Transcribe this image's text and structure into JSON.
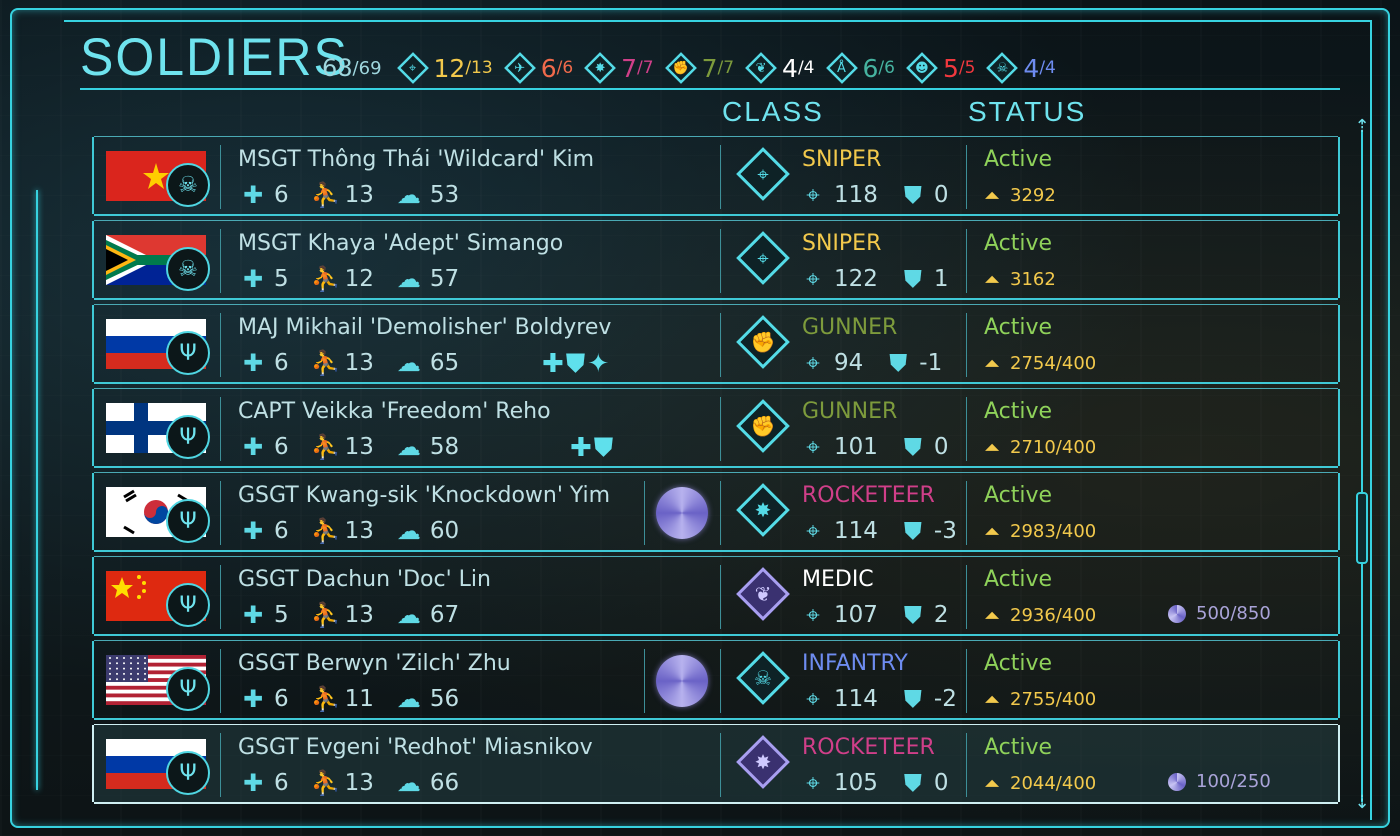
{
  "screen": {
    "title": "SOLDIERS",
    "total": {
      "count": "68",
      "max": "/69"
    },
    "class_counts": [
      {
        "icon": "sniper-class-icon",
        "count": "12",
        "max": "/13",
        "color": "#f2c94c"
      },
      {
        "icon": "scout-class-icon",
        "count": "6",
        "max": "/6",
        "color": "#f06a4b"
      },
      {
        "icon": "rocketeer-class-icon",
        "count": "7",
        "max": "/7",
        "color": "#d03f89"
      },
      {
        "icon": "gunner-class-icon",
        "count": "7",
        "max": "/7",
        "color": "#7d9b3c"
      },
      {
        "icon": "medic-class-icon",
        "count": "4",
        "max": "/4",
        "color": "#ffffff"
      },
      {
        "icon": "engineer-class-icon",
        "count": "6",
        "max": "/6",
        "color": "#46b3a0"
      },
      {
        "icon": "alien-class-icon",
        "count": "5",
        "max": "/5",
        "color": "#f0383e"
      },
      {
        "icon": "infantry-class-icon",
        "count": "4",
        "max": "/4",
        "color": "#6e8cf0"
      }
    ],
    "col_class": "CLASS",
    "col_status": "STATUS"
  },
  "soldiers": [
    {
      "name": "MSGT Thông Thái 'Wildcard' Kim",
      "flag": "vietnam",
      "rank_icon": "laurel-skull-icon",
      "hp": "6",
      "mobility": "13",
      "will": "53",
      "perks": [],
      "psi_gift": false,
      "class": "SNIPER",
      "class_color": "#f2c94c",
      "class_icon": "sniper-class-icon",
      "aim": "118",
      "defense": "0",
      "status": "Active",
      "xp": "3292",
      "psi_xp": ""
    },
    {
      "name": "MSGT Khaya 'Adept' Simango",
      "flag": "south-africa",
      "rank_icon": "laurel-skull-icon",
      "hp": "5",
      "mobility": "12",
      "will": "57",
      "perks": [],
      "psi_gift": false,
      "class": "SNIPER",
      "class_color": "#f2c94c",
      "class_icon": "sniper-class-icon",
      "aim": "122",
      "defense": "1",
      "status": "Active",
      "xp": "3162",
      "psi_xp": ""
    },
    {
      "name": "MAJ Mikhail 'Demolisher' Boldyrev",
      "flag": "russia",
      "rank_icon": "trident-rank-icon",
      "hp": "6",
      "mobility": "13",
      "will": "65",
      "perks": [
        "health-perk-icon",
        "shield-perk-icon",
        "mobility-perk-icon"
      ],
      "psi_gift": false,
      "class": "GUNNER",
      "class_color": "#7d9b3c",
      "class_icon": "gunner-class-icon",
      "aim": "94",
      "defense": "-1",
      "status": "Active",
      "xp": "2754/400",
      "psi_xp": ""
    },
    {
      "name": "CAPT Veikka 'Freedom' Reho",
      "flag": "finland",
      "rank_icon": "trident-rank-icon",
      "hp": "6",
      "mobility": "13",
      "will": "58",
      "perks": [
        "health-perk-icon",
        "shield-perk-icon"
      ],
      "psi_gift": false,
      "class": "GUNNER",
      "class_color": "#7d9b3c",
      "class_icon": "gunner-class-icon",
      "aim": "101",
      "defense": "0",
      "status": "Active",
      "xp": "2710/400",
      "psi_xp": ""
    },
    {
      "name": "GSGT Kwang-sik 'Knockdown' Yim",
      "flag": "south-korea",
      "rank_icon": "trident-rank-icon",
      "hp": "6",
      "mobility": "13",
      "will": "60",
      "perks": [],
      "psi_gift": true,
      "class": "ROCKETEER",
      "class_color": "#d03f89",
      "class_icon": "rocketeer-class-icon",
      "aim": "114",
      "defense": "-3",
      "status": "Active",
      "xp": "2983/400",
      "psi_xp": ""
    },
    {
      "name": "GSGT Dachun 'Doc' Lin",
      "flag": "china",
      "rank_icon": "trident-rank-icon",
      "hp": "5",
      "mobility": "13",
      "will": "67",
      "perks": [],
      "psi_gift": false,
      "class": "MEDIC",
      "class_color": "#ffffff",
      "class_icon": "medic-class-icon",
      "aim": "107",
      "defense": "2",
      "status": "Active",
      "xp": "2936/400",
      "psi_xp": "500/850"
    },
    {
      "name": "GSGT Berwyn 'Zilch' Zhu",
      "flag": "usa",
      "rank_icon": "trident-rank-icon",
      "hp": "6",
      "mobility": "11",
      "will": "56",
      "perks": [],
      "psi_gift": true,
      "class": "INFANTRY",
      "class_color": "#6e8cf0",
      "class_icon": "infantry-class-icon",
      "aim": "114",
      "defense": "-2",
      "status": "Active",
      "xp": "2755/400",
      "psi_xp": ""
    },
    {
      "name": "GSGT Evgeni 'Redhot' Miasnikov",
      "flag": "russia",
      "rank_icon": "trident-rank-icon",
      "hp": "6",
      "mobility": "13",
      "will": "66",
      "perks": [],
      "psi_gift": false,
      "class": "ROCKETEER",
      "class_color": "#d03f89",
      "class_icon": "rocketeer-psi-class-icon",
      "aim": "105",
      "defense": "0",
      "status": "Active",
      "xp": "2044/400",
      "psi_xp": "100/250"
    }
  ],
  "selected_index": 7,
  "colors": {
    "accent": "#37d2e0",
    "active": "#8fd25a",
    "xp": "#f2c94c",
    "psi": "#a9a3d8"
  }
}
